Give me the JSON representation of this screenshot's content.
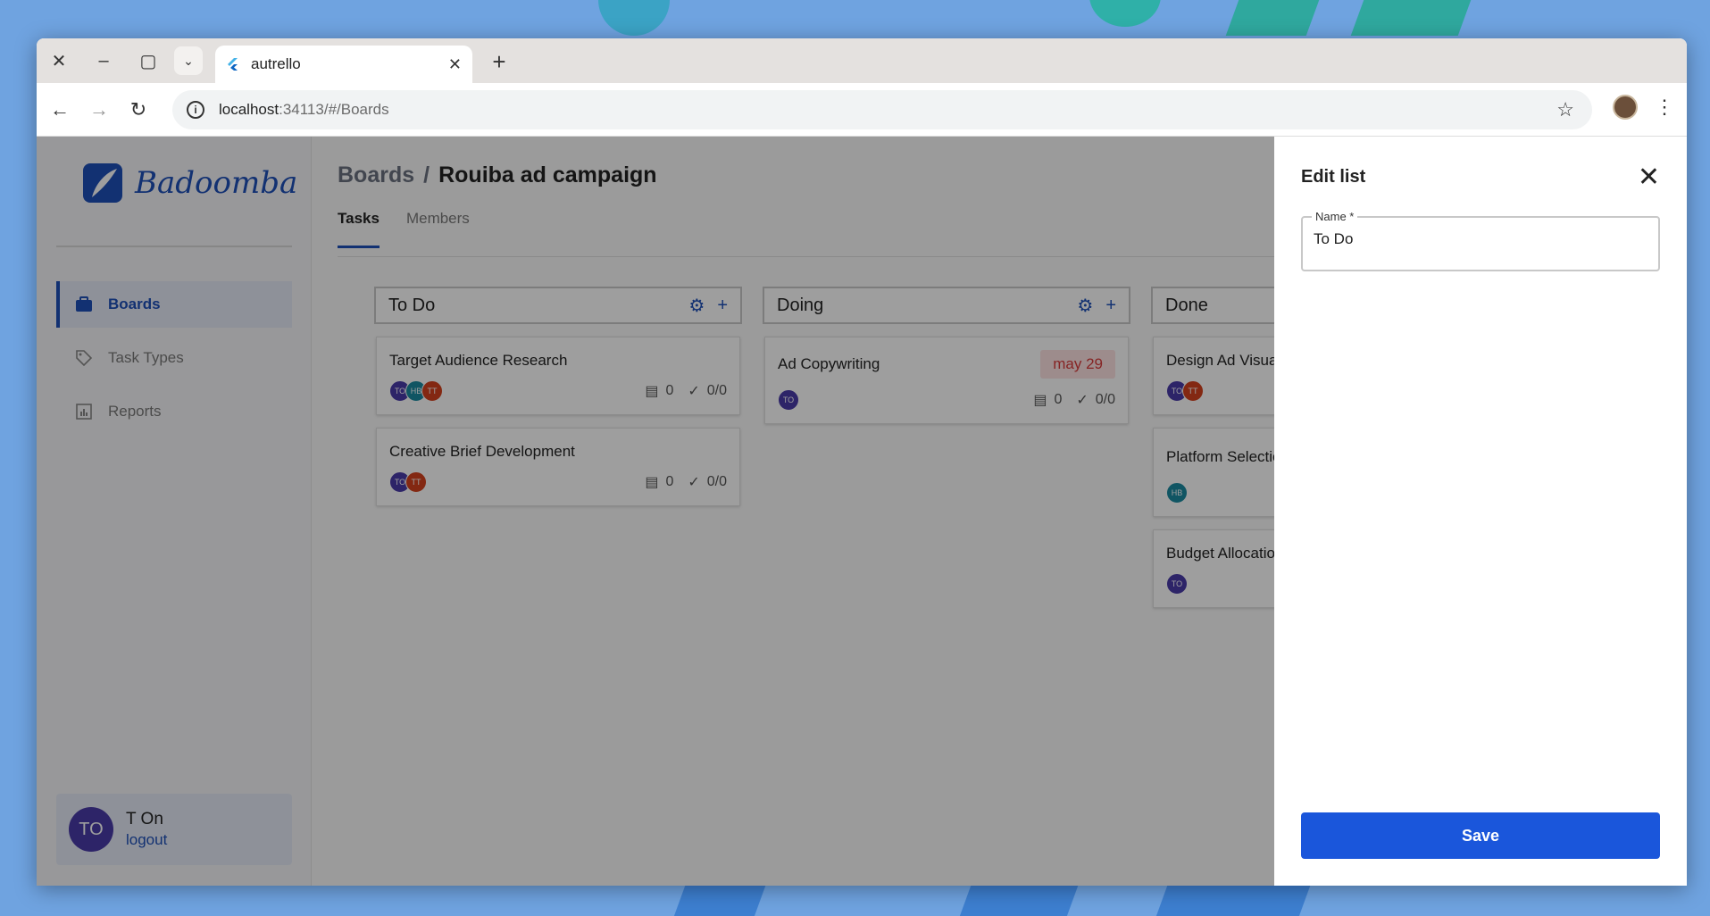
{
  "browser": {
    "tab_title": "autrello",
    "url_host": "localhost",
    "url_rest": ":34113/#/Boards"
  },
  "sidebar": {
    "brand": "Badoomba",
    "items": [
      {
        "label": "Boards",
        "icon": "briefcase-icon"
      },
      {
        "label": "Task Types",
        "icon": "tag-icon"
      },
      {
        "label": "Reports",
        "icon": "chart-icon"
      }
    ],
    "user": {
      "initials": "TO",
      "name": "T On",
      "logout": "logout"
    }
  },
  "main": {
    "breadcrumb": {
      "parent": "Boards",
      "separator": "/",
      "current": "Rouiba ad campaign"
    },
    "tabs": [
      {
        "label": "Tasks"
      },
      {
        "label": "Members"
      }
    ],
    "columns": [
      {
        "title": "To Do",
        "cards": [
          {
            "title": "Target Audience Research",
            "avatars": [
              "TO",
              "HB",
              "TT"
            ],
            "comments": "0",
            "checklist": "0/0"
          },
          {
            "title": "Creative Brief Development",
            "avatars": [
              "TO",
              "TT"
            ],
            "comments": "0",
            "checklist": "0/0"
          }
        ]
      },
      {
        "title": "Doing",
        "cards": [
          {
            "title": "Ad Copywriting",
            "due": "may 29",
            "avatars": [
              "TO"
            ],
            "comments": "0",
            "checklist": "0/0"
          }
        ]
      },
      {
        "title": "Done",
        "cards": [
          {
            "title": "Design Ad Visuals",
            "avatars": [
              "TO",
              "TT"
            ]
          },
          {
            "title": "Platform Selection",
            "avatars": [
              "HB"
            ]
          },
          {
            "title": "Budget Allocation",
            "avatars": [
              "TO"
            ]
          }
        ]
      }
    ]
  },
  "drawer": {
    "title": "Edit list",
    "field_label": "Name *",
    "field_value": "To Do",
    "save_label": "Save"
  },
  "colors": {
    "accent": "#1e4fb8",
    "save_button": "#1a56db",
    "avatar_TO": "#4a3aa8",
    "avatar_HB": "#1a8aa0",
    "avatar_TT": "#d4421e",
    "due_bg": "#fde2e2",
    "due_text": "#d93b3b"
  }
}
